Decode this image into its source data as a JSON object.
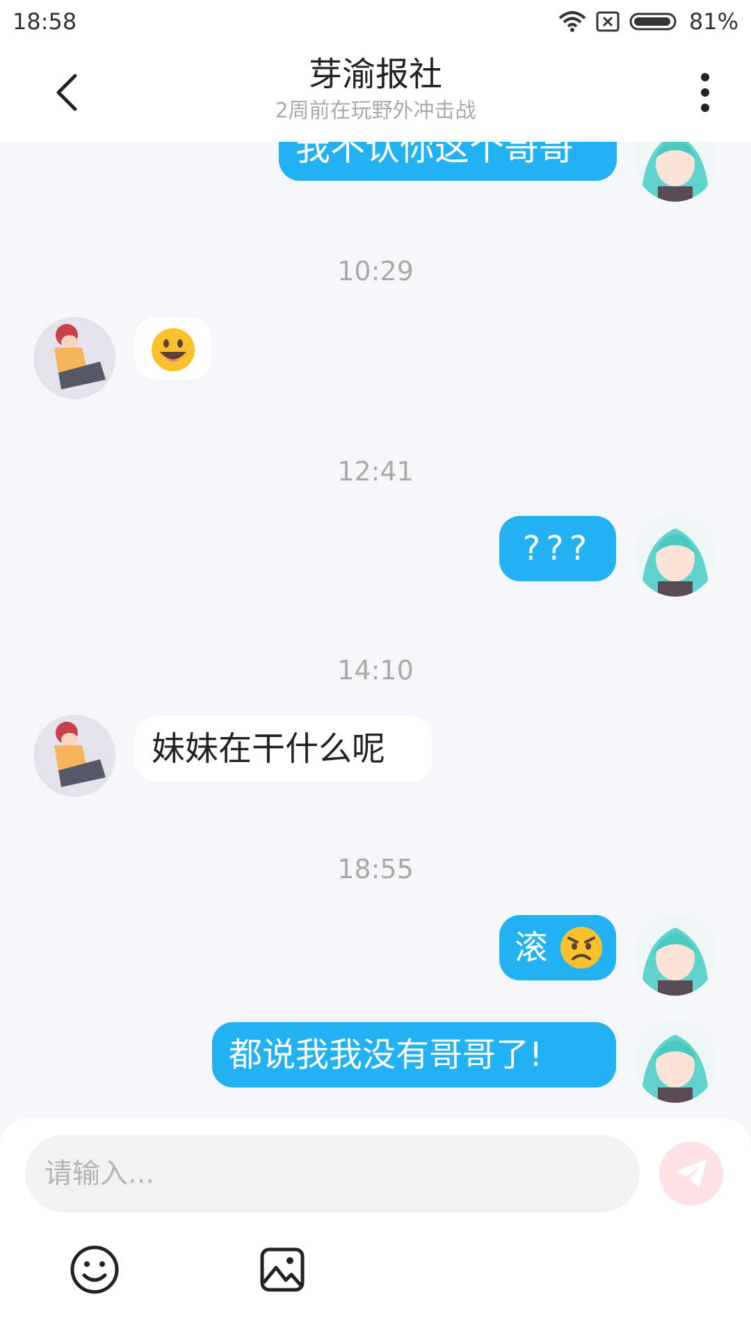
{
  "status_bar": {
    "time": "18:58",
    "battery": "81%",
    "icons": [
      "wifi-icon",
      "sim-x-icon",
      "battery-icon"
    ]
  },
  "header": {
    "title": "芽渝报社",
    "subtitle": "2周前在玩野外冲击战",
    "icons": [
      "back-icon",
      "more-icon"
    ]
  },
  "messages": {
    "m1_partial": "我不认你这个哥哥",
    "time1": "10:29",
    "m2_emoji": "grinning-face-emoji",
    "time2": "12:41",
    "m3": "???",
    "time3": "14:10",
    "m4": "妹妹在干什么呢",
    "time4": "18:55",
    "m5": "滚",
    "m5_emoji": "angry-face-emoji",
    "m6": "都说我我没有哥哥了!"
  },
  "input": {
    "placeholder": "请输入...",
    "icons": [
      "send-icon",
      "emoji-icon",
      "image-icon"
    ]
  },
  "colors": {
    "outgoing_bubble": "#22b2f4",
    "incoming_bubble": "#ffffff",
    "background": "#f5f6f8",
    "send_button": "#fde3e6"
  }
}
